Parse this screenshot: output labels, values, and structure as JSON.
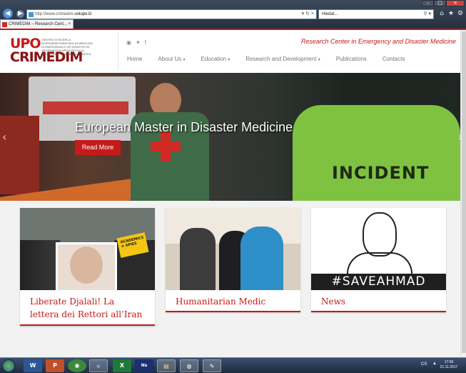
{
  "browser": {
    "url_prefix": "http://www.crimedim.",
    "url_domain": "uniupo.it",
    "url_suffix": "/",
    "search_placeholder": "Hledat...",
    "tab_title": "CRIMEDIM – Research Cent...",
    "tab_close": "×",
    "window_controls": [
      "–",
      "□",
      "×"
    ],
    "nav_icons": [
      "back-icon",
      "forward-icon"
    ],
    "toolbar_icons": [
      "home-icon",
      "star-icon",
      "gear-icon"
    ]
  },
  "site": {
    "logo_upo": "UPO",
    "logo_crimedim": "CRIMEDIM",
    "logo_subtext": "CENTRO DI RICERCA INTERDIPARTIMENTALE IN MEDICINA DI EMERGENZA E DEI DISASTRI ED INFORMATICA APPLICATA ALLA DIDATTICA E ALLA PRATICA MEDICA",
    "tagline": "Research Center in Emergency and Disaster Medicine",
    "social": [
      "rss-icon",
      "twitter-icon",
      "facebook-icon"
    ],
    "menu": [
      {
        "label": "Home",
        "dropdown": false
      },
      {
        "label": "About Us",
        "dropdown": true
      },
      {
        "label": "Education",
        "dropdown": true
      },
      {
        "label": "Research and Development",
        "dropdown": true
      },
      {
        "label": "Publications",
        "dropdown": false
      },
      {
        "label": "Contacts",
        "dropdown": false
      }
    ]
  },
  "hero": {
    "title": "European Master in Disaster Medicine",
    "button": "Read More",
    "photo_text": "INCIDENT",
    "arrows": [
      "‹",
      "›"
    ]
  },
  "cards": [
    {
      "title": "Liberate Djalali! La lettera dei Rettori all’Iran",
      "image_sign": "ACADEMICS ≠ SPIES"
    },
    {
      "title": "Humanitarian Medic"
    },
    {
      "title": "News",
      "image_text": "#SAVEAHMAD"
    }
  ],
  "taskbar": {
    "apps": [
      "W",
      "P",
      "◉",
      "e",
      "X",
      "Ns",
      "▤",
      "◍",
      "✎"
    ],
    "language": "CS",
    "time": "17:09",
    "date": "21.11.2017"
  },
  "colors": {
    "accent": "#c41a1a",
    "vest_green": "#7fc241",
    "taskbar": "#1d2b40"
  }
}
